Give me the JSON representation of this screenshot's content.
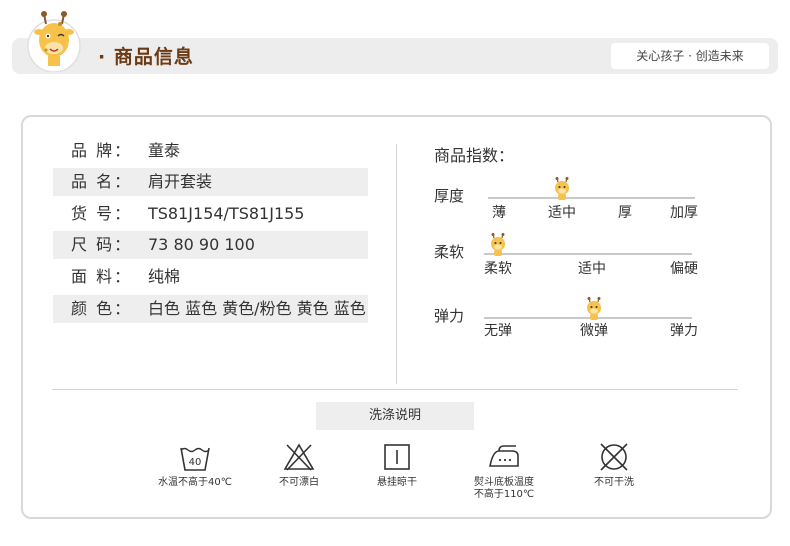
{
  "header": {
    "title": "· 商品信息",
    "slogan": "关心孩子 · 创造未来"
  },
  "product": {
    "rows": [
      {
        "label": "品  牌：",
        "value": "童泰",
        "shaded": false
      },
      {
        "label": "品  名：",
        "value": "肩开套装",
        "shaded": true
      },
      {
        "label": "货  号：",
        "value": "TS81J154/TS81J155",
        "shaded": false
      },
      {
        "label": "尺  码：",
        "value": "73 80 90 100",
        "shaded": true
      },
      {
        "label": "面  料：",
        "value": "纯棉",
        "shaded": false
      },
      {
        "label": "颜  色：",
        "value": "白色 蓝色 黄色/粉色 黄色 蓝色",
        "shaded": true
      }
    ]
  },
  "index": {
    "title": "商品指数：",
    "scales": [
      {
        "name": "厚度",
        "ticks": [
          "薄",
          "适中",
          "厚",
          "加厚"
        ],
        "selected": 1
      },
      {
        "name": "柔软",
        "ticks": [
          "柔软",
          "适中",
          "偏硬"
        ],
        "selected": 0
      },
      {
        "name": "弹力",
        "ticks": [
          "无弹",
          "微弹",
          "弹力"
        ],
        "selected": 1
      }
    ]
  },
  "care": {
    "title": "洗涤说明",
    "items": [
      {
        "icon": "wash-40-icon",
        "text": "水温不高于40℃",
        "temp": "40"
      },
      {
        "icon": "no-bleach-icon",
        "text": "不可漂白"
      },
      {
        "icon": "hang-dry-icon",
        "text": "悬挂晾干"
      },
      {
        "icon": "iron-icon",
        "text": "熨斗底板温度",
        "text2": "不高于110℃"
      },
      {
        "icon": "no-dry-clean-icon",
        "text": "不可干洗"
      }
    ]
  },
  "colors": {
    "title": "#6a3b14",
    "mascot": "#f6c24a",
    "border": "#d9d9d9",
    "shade": "#eeeeee"
  }
}
